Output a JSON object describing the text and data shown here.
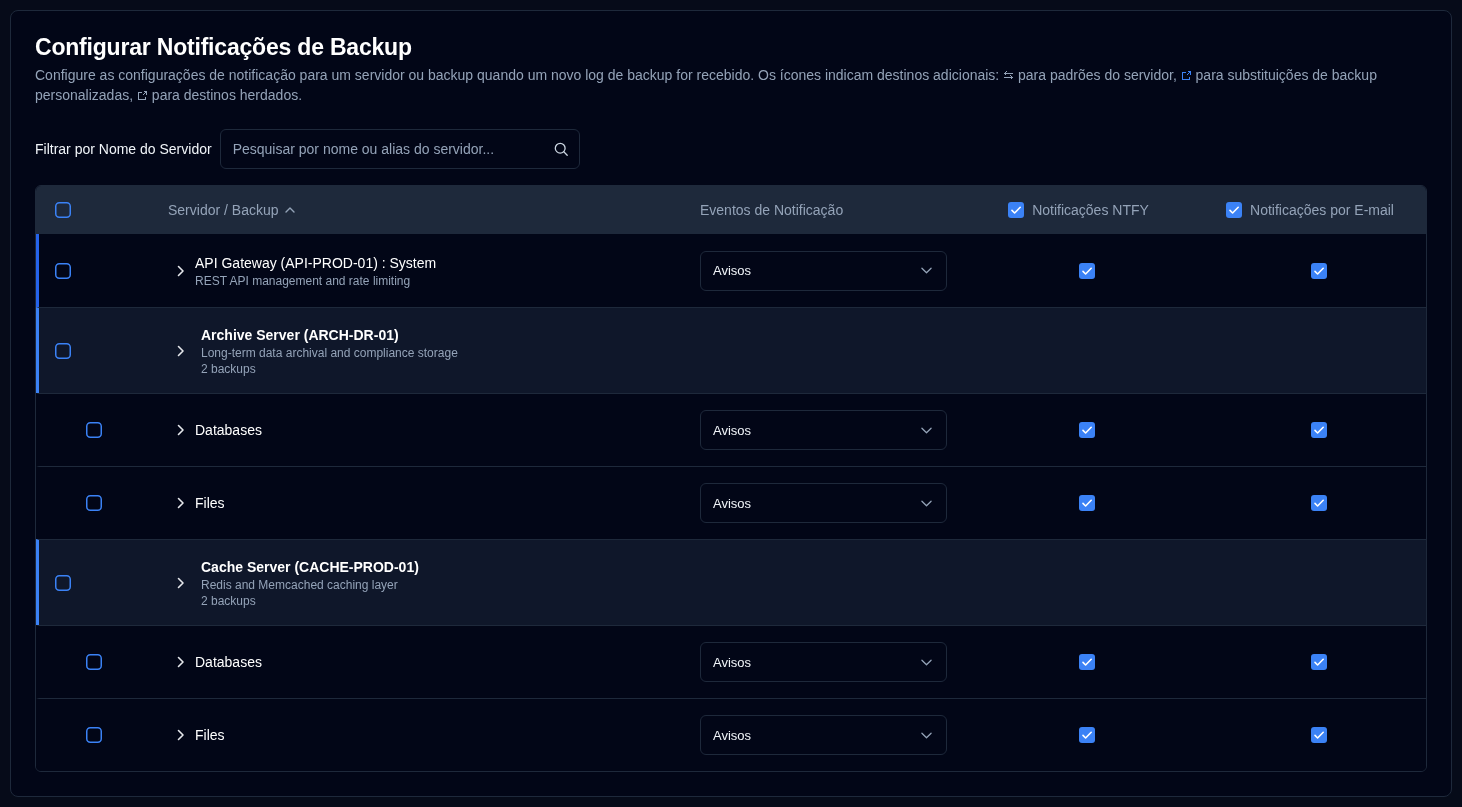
{
  "title": "Configurar Notificações de Backup",
  "description": {
    "intro": "Configure as configurações de notificação para um servidor ou backup quando um novo log de backup for recebido. Os ícones indicam destinos adicionais:",
    "legend": [
      {
        "kind": "swap",
        "color": "#94a3b8",
        "text": "para padrões do servidor,"
      },
      {
        "kind": "link",
        "color": "#3b82f6",
        "text": "para substituições de backup personalizadas,"
      },
      {
        "kind": "link",
        "color": "#94a3b8",
        "text": "para destinos herdados."
      }
    ]
  },
  "filter": {
    "label": "Filtrar por Nome do Servidor",
    "placeholder": "Pesquisar por nome ou alias do servidor..."
  },
  "table": {
    "select_all": {
      "checked": false
    },
    "columns": [
      {
        "kind": "sortable",
        "label": "Servidor / Backup",
        "sort_ascending": true
      },
      {
        "kind": "plain",
        "label": "Eventos de Notificação"
      },
      {
        "kind": "toggle",
        "label": "Notificações NTFY",
        "checked": true
      },
      {
        "kind": "toggle",
        "label": "Notificações por E-mail",
        "checked": true
      }
    ],
    "rows": [
      {
        "kind": "single",
        "checked": false,
        "name": "API Gateway (API-PROD-01) : System",
        "description": "REST API management and rate limiting",
        "events": "Avisos",
        "ntfy": true,
        "email": true
      },
      {
        "kind": "group",
        "checked": false,
        "name": "Archive Server (ARCH-DR-01)",
        "description": "Long-term data archival and compliance storage",
        "count": "2 backups",
        "children": [
          {
            "kind": "backup",
            "checked": false,
            "name": "Databases",
            "events": "Avisos",
            "ntfy": true,
            "email": true
          },
          {
            "kind": "backup",
            "checked": false,
            "name": "Files",
            "events": "Avisos",
            "ntfy": true,
            "email": true
          }
        ]
      },
      {
        "kind": "group",
        "checked": false,
        "name": "Cache Server (CACHE-PROD-01)",
        "description": "Redis and Memcached caching layer",
        "count": "2 backups",
        "children": [
          {
            "kind": "backup",
            "checked": false,
            "name": "Databases",
            "events": "Avisos",
            "ntfy": true,
            "email": true
          },
          {
            "kind": "backup",
            "checked": false,
            "name": "Files",
            "events": "Avisos",
            "ntfy": true,
            "email": true
          }
        ]
      }
    ]
  }
}
